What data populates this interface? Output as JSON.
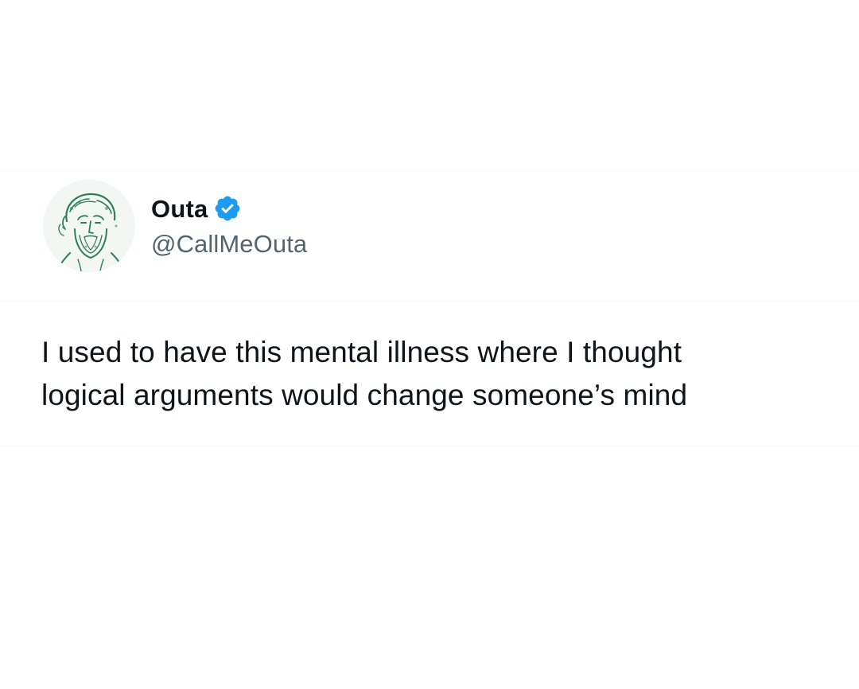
{
  "tweet": {
    "author": {
      "display_name": "Outa",
      "handle": "@CallMeOuta",
      "verified": true,
      "avatar_icon": "bearded-philosopher-sketch-avatar",
      "verified_icon": "verified-badge-icon"
    },
    "text": "I used to have this mental illness where I thought\nlogical arguments would change someone’s mind"
  },
  "colors": {
    "background": "#ffffff",
    "text_primary": "#0f1419",
    "text_secondary": "#536471",
    "verified_blue": "#1d9bf0",
    "avatar_ink": "#2e7d5b"
  }
}
